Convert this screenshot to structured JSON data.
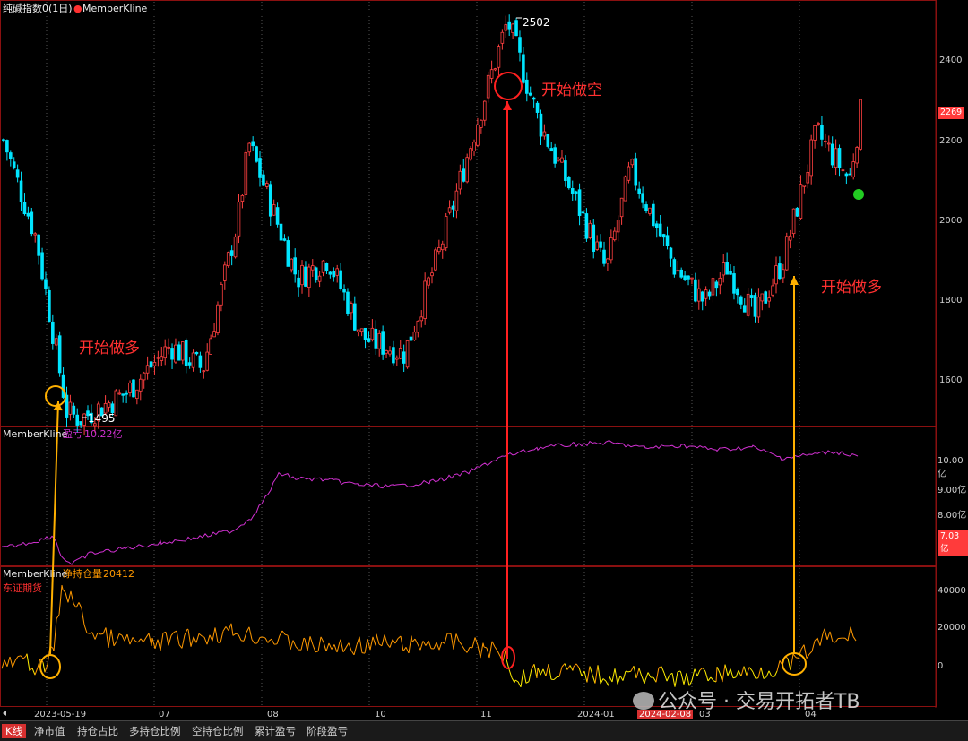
{
  "panel1": {
    "title": "纯碱指数0(1日)",
    "indicator": "MemberKline",
    "y_ticks": [
      "2400",
      "2200",
      "2000",
      "1800",
      "1600"
    ],
    "current_price": "2269",
    "high_label": "2502",
    "low_label": "1495"
  },
  "panel2": {
    "title": "MemberKline",
    "metric": "盈亏",
    "value": "10.22亿",
    "y_ticks": [
      "10.00亿",
      "9.00亿",
      "8.00亿"
    ],
    "current_value": "7.03亿"
  },
  "panel3": {
    "title": "MemberKline",
    "metric": "净持仓量",
    "value": "20412",
    "member": "东证期货",
    "y_ticks": [
      "40000",
      "20000",
      "0"
    ]
  },
  "x_axis": {
    "labels": [
      "2023-05-19",
      "07",
      "08",
      "10",
      "11",
      "2024-01",
      "2024-02-08",
      "03",
      "04"
    ],
    "highlighted": "2024-02-08"
  },
  "annotations": {
    "long1": "开始做多",
    "short": "开始做空",
    "long2": "开始做多"
  },
  "watermark": "公众号 · 交易开拓者TB",
  "tabs": [
    "K线",
    "净市值",
    "持仓占比",
    "多持仓比例",
    "空持仓比例",
    "累计盈亏",
    "阶段盈亏"
  ],
  "colors": {
    "up": "#ff4040",
    "down": "#00e5ff",
    "pnl_line": "#d030d0",
    "pos_line": "#ff9900",
    "pos_line_neg": "#ffee00",
    "arrow_yellow": "#ffb000",
    "arrow_red": "#ff2020",
    "accent": "#d73030"
  },
  "chart_data": {
    "type": "candlestick",
    "price_anchors": [
      [
        "2023-04-20",
        2200
      ],
      [
        "2023-05-05",
        1950
      ],
      [
        "2023-05-19",
        1510
      ],
      [
        "2023-05-25",
        1495
      ],
      [
        "2023-06-15",
        1560
      ],
      [
        "2023-07-05",
        1680
      ],
      [
        "2023-07-20",
        1620
      ],
      [
        "2023-08-05",
        2000
      ],
      [
        "2023-08-10",
        2190
      ],
      [
        "2023-09-01",
        1850
      ],
      [
        "2023-09-15",
        1900
      ],
      [
        "2023-10-01",
        1700
      ],
      [
        "2023-10-20",
        1660
      ],
      [
        "2023-11-05",
        1920
      ],
      [
        "2023-11-25",
        2300
      ],
      [
        "2023-12-06",
        2502
      ],
      [
        "2023-12-20",
        2250
      ],
      [
        "2024-01-05",
        2060
      ],
      [
        "2024-01-20",
        1870
      ],
      [
        "2024-01-31",
        2130
      ],
      [
        "2024-02-20",
        1880
      ],
      [
        "2024-03-05",
        1790
      ],
      [
        "2024-03-15",
        1880
      ],
      [
        "2024-03-28",
        1750
      ],
      [
        "2024-04-10",
        1900
      ],
      [
        "2024-04-25",
        2220
      ],
      [
        "2024-05-10",
        2100
      ],
      [
        "2024-05-15",
        2269
      ]
    ],
    "price_ylim": [
      1470,
      2550
    ]
  }
}
